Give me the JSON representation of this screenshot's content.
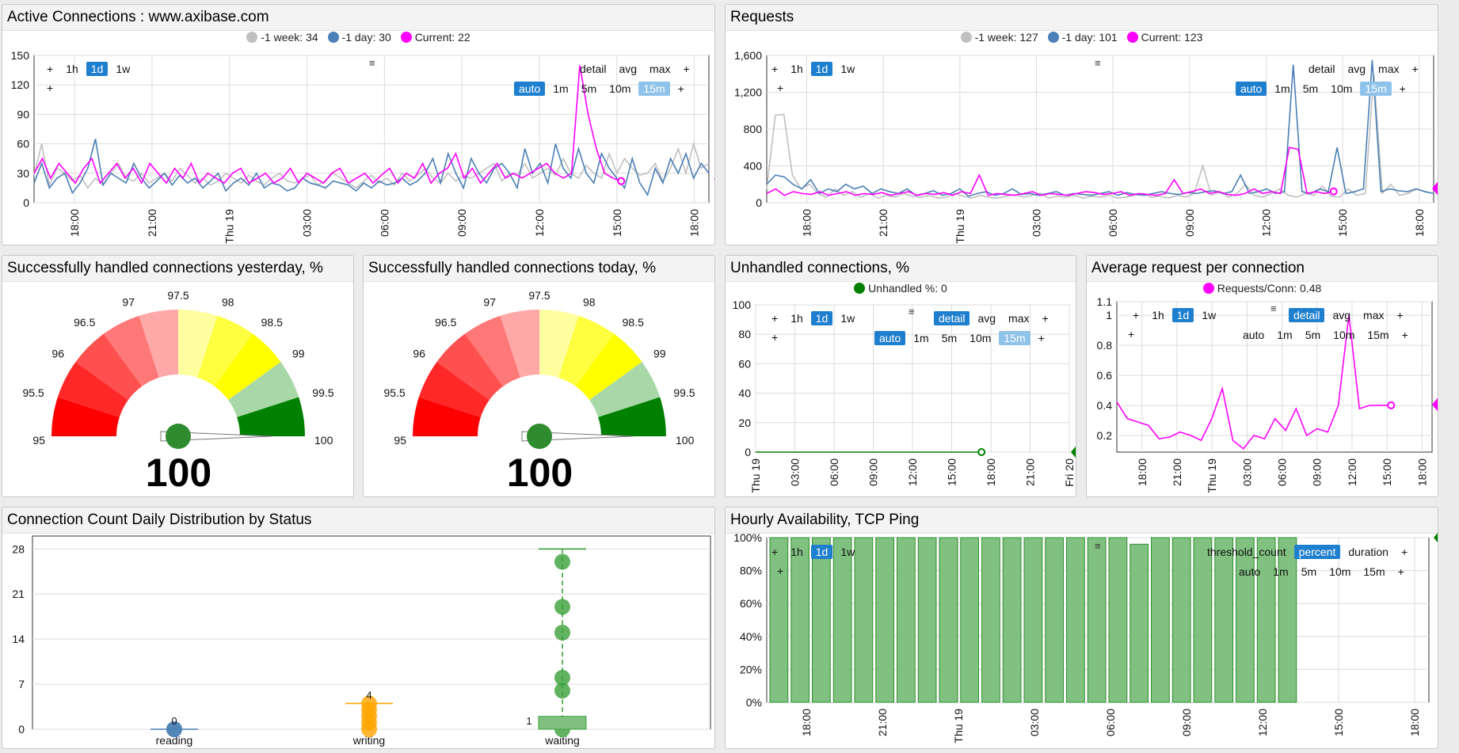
{
  "colors": {
    "week": "#c0c0c0",
    "day": "#4b7fb5",
    "current": "#ff00ff",
    "green": "#008000",
    "bar": "#80c080",
    "orange": "#ffa500"
  },
  "controls": {
    "plus": "+",
    "periods": [
      "1h",
      "1d",
      "1w"
    ],
    "stats": [
      "detail",
      "avg",
      "max"
    ],
    "intervals": [
      "auto",
      "1m",
      "5m",
      "10m",
      "15m"
    ],
    "menu_icon": "≡",
    "threshold_count": "threshold_count",
    "percent": "percent",
    "duration": "duration"
  },
  "active": {
    "title": "Active Connections : www.axibase.com",
    "legend": [
      "-1 week: 34",
      "-1 day: 30",
      "Current: 22"
    ],
    "yticks": [
      "150",
      "120",
      "90",
      "60",
      "30",
      "0"
    ],
    "xticks": [
      "18:00",
      "21:00",
      "Thu 19",
      "03:00",
      "06:00",
      "09:00",
      "12:00",
      "15:00",
      "18:00"
    ],
    "current_badge": "22",
    "chart_data": {
      "type": "line",
      "ylim": [
        0,
        150
      ],
      "x_range": [
        "Wed 18 16:30",
        "Thu 19 18:30"
      ],
      "series": [
        {
          "name": "-1 week",
          "values": [
            28,
            60,
            18,
            35,
            30,
            22,
            28,
            15,
            25,
            18,
            30,
            40,
            25,
            22,
            30,
            20,
            25,
            30,
            22,
            35,
            28,
            20,
            25,
            18,
            22,
            30,
            25,
            20,
            28,
            22,
            18,
            25,
            30,
            22,
            20,
            25,
            28,
            18,
            22,
            30,
            25,
            20,
            15,
            22,
            28,
            20,
            25,
            18,
            30,
            22,
            28,
            35,
            25,
            20,
            30,
            22,
            28,
            25,
            30,
            35,
            40,
            22,
            30,
            28,
            40,
            25,
            30,
            35,
            28,
            45,
            30,
            25,
            38,
            30,
            25,
            50,
            30,
            45,
            35,
            28,
            30,
            40,
            22,
            35,
            55,
            30,
            60,
            35,
            40
          ]
        },
        {
          "name": "-1 day",
          "values": [
            20,
            40,
            15,
            25,
            30,
            10,
            20,
            35,
            65,
            18,
            30,
            25,
            20,
            40,
            25,
            15,
            22,
            30,
            18,
            28,
            20,
            25,
            15,
            22,
            30,
            12,
            20,
            25,
            18,
            30,
            15,
            20,
            18,
            12,
            15,
            25,
            20,
            18,
            15,
            22,
            20,
            18,
            12,
            20,
            15,
            22,
            18,
            20,
            25,
            18,
            22,
            30,
            45,
            20,
            50,
            30,
            15,
            45,
            30,
            20,
            35,
            40,
            30,
            15,
            55,
            30,
            40,
            20,
            60,
            35,
            25,
            55,
            30,
            20,
            50,
            35,
            25,
            15,
            45,
            20,
            8,
            35,
            20,
            45,
            30,
            50,
            25,
            40,
            30
          ]
        },
        {
          "name": "Current",
          "values": [
            30,
            45,
            25,
            40,
            30,
            20,
            35,
            45,
            20,
            30,
            40,
            25,
            35,
            20,
            40,
            30,
            20,
            35,
            25,
            40,
            20,
            30,
            25,
            20,
            30,
            35,
            20,
            25,
            30,
            20,
            25,
            35,
            20,
            30,
            25,
            20,
            30,
            35,
            20,
            25,
            30,
            20,
            28,
            35,
            20,
            30,
            25,
            40,
            20,
            30,
            35,
            50,
            25,
            35,
            20,
            30,
            40,
            25,
            30,
            25,
            30,
            35,
            40,
            30,
            25,
            30,
            140,
            90,
            55,
            30,
            25,
            22
          ]
        }
      ]
    }
  },
  "requests": {
    "title": "Requests",
    "legend": [
      "-1 week: 127",
      "-1 day: 101",
      "Current: 123"
    ],
    "yticks": [
      "1,600",
      "1,200",
      "800",
      "400",
      "0"
    ],
    "xticks": [
      "18:00",
      "21:00",
      "Thu 19",
      "03:00",
      "06:00",
      "09:00",
      "12:00",
      "15:00",
      "18:00"
    ],
    "current_badge": "123",
    "chart_data": {
      "type": "line",
      "ylim": [
        0,
        1600
      ],
      "series": [
        {
          "name": "-1 week",
          "values": [
            150,
            950,
            960,
            300,
            150,
            200,
            100,
            60,
            150,
            80,
            120,
            60,
            100,
            50,
            80,
            60,
            100,
            70,
            60,
            80,
            50,
            60,
            100,
            70,
            50,
            80,
            60,
            50,
            70,
            90,
            60,
            80,
            100,
            50,
            70,
            60,
            80,
            50,
            70,
            60,
            80,
            50,
            60,
            80,
            100,
            60,
            70,
            50,
            80,
            60,
            100,
            400,
            80,
            120,
            60,
            100,
            200,
            80,
            60,
            100,
            150,
            80,
            60,
            100,
            80,
            180,
            70,
            60,
            150,
            80,
            100,
            1400,
            100,
            200,
            80,
            100,
            150,
            120,
            100
          ]
        },
        {
          "name": "-1 day",
          "values": [
            200,
            300,
            280,
            200,
            150,
            250,
            100,
            150,
            120,
            200,
            150,
            180,
            100,
            150,
            120,
            100,
            150,
            80,
            100,
            130,
            80,
            100,
            150,
            70,
            100,
            120,
            80,
            100,
            150,
            90,
            100,
            80,
            100,
            120,
            80,
            100,
            90,
            80,
            100,
            120,
            80,
            110,
            90,
            80,
            100,
            120,
            100,
            90,
            110,
            100,
            120,
            130,
            100,
            120,
            300,
            100,
            120,
            150,
            100,
            120,
            1500,
            120,
            100,
            150,
            120,
            600,
            100,
            120,
            150,
            1550,
            120,
            150,
            130,
            120,
            150,
            120,
            100
          ]
        },
        {
          "name": "Current",
          "values": [
            100,
            150,
            80,
            120,
            100,
            90,
            120,
            80,
            100,
            120,
            80,
            100,
            90,
            110,
            80,
            100,
            120,
            80,
            100,
            90,
            110,
            80,
            120,
            100,
            300,
            80,
            100,
            90,
            80,
            100,
            120,
            80,
            100,
            90,
            80,
            100,
            120,
            110,
            90,
            100,
            120,
            80,
            100,
            90,
            80,
            100,
            250,
            100,
            120,
            150,
            100,
            120,
            90,
            80,
            100,
            150,
            100,
            120,
            100,
            600,
            580,
            100,
            120,
            100,
            123
          ]
        }
      ]
    }
  },
  "gauge_yesterday": {
    "title": "Successfully handled connections yesterday, %",
    "value": "100",
    "ticks": [
      "95",
      "95.5",
      "96",
      "96.5",
      "97",
      "97.5",
      "98",
      "98.5",
      "99",
      "99.5",
      "100"
    ]
  },
  "gauge_today": {
    "title": "Successfully handled connections today, %",
    "value": "100",
    "ticks": [
      "95",
      "95.5",
      "96",
      "96.5",
      "97",
      "97.5",
      "98",
      "98.5",
      "99",
      "99.5",
      "100"
    ]
  },
  "unhandled": {
    "title": "Unhandled connections, %",
    "legend": "Unhandled %: 0",
    "yticks": [
      "100",
      "80",
      "60",
      "40",
      "20",
      "0"
    ],
    "xticks": [
      "Thu 19",
      "03:00",
      "06:00",
      "09:00",
      "12:00",
      "15:00",
      "18:00",
      "21:00",
      "Fri 20"
    ],
    "current_badge": "0",
    "chart_data": {
      "type": "line",
      "ylim": [
        0,
        100
      ],
      "series": [
        {
          "name": "Unhandled %",
          "values": [
            0,
            0,
            0,
            0,
            0,
            0,
            0,
            0
          ]
        }
      ]
    }
  },
  "avgreq": {
    "title": "Average request per connection",
    "legend": "Requests/Conn: 0.48",
    "yticks": [
      "1.1",
      "1",
      "0.8",
      "0.6",
      "0.4",
      "0.2"
    ],
    "xticks": [
      "18:00",
      "21:00",
      "Thu 19",
      "03:00",
      "06:00",
      "09:00",
      "12:00",
      "15:00",
      "18:00"
    ],
    "current_badge": "0.48",
    "chart_data": {
      "type": "line",
      "ylim": [
        0.2,
        1.1
      ],
      "series": [
        {
          "name": "Requests/Conn",
          "values": [
            0.5,
            0.4,
            0.38,
            0.36,
            0.28,
            0.29,
            0.32,
            0.3,
            0.27,
            0.4,
            0.58,
            0.27,
            0.22,
            0.3,
            0.28,
            0.4,
            0.33,
            0.46,
            0.3,
            0.34,
            0.32,
            0.48,
            1.02,
            0.46,
            0.48,
            0.48,
            0.48
          ]
        }
      ]
    }
  },
  "distribution": {
    "title": "Connection Count Daily Distribution by Status",
    "yticks": [
      "28",
      "21",
      "14",
      "7",
      "0"
    ],
    "categories": [
      "reading",
      "writing",
      "waiting"
    ],
    "labels": {
      "reading": "0",
      "writing": "4",
      "waiting": "1"
    },
    "chart_data": {
      "type": "box",
      "ylim": [
        0,
        30
      ],
      "series": [
        {
          "name": "reading",
          "min": 0,
          "max": 0,
          "points": [
            0,
            0
          ]
        },
        {
          "name": "writing",
          "min": 0,
          "max": 4,
          "points": [
            0,
            1,
            2,
            3,
            4
          ]
        },
        {
          "name": "waiting",
          "min": 0,
          "max": 28,
          "points": [
            0,
            6,
            8,
            15,
            19,
            26
          ]
        }
      ]
    }
  },
  "availability": {
    "title": "Hourly Availability, TCP Ping",
    "yticks": [
      "100%",
      "80%",
      "60%",
      "40%",
      "20%",
      "0%"
    ],
    "xticks": [
      "18:00",
      "21:00",
      "Thu 19",
      "03:00",
      "06:00",
      "09:00",
      "12:00",
      "15:00",
      "18:00"
    ],
    "current_badge": "100",
    "chart_data": {
      "type": "bar",
      "ylim": [
        0,
        100
      ],
      "values": [
        100,
        100,
        100,
        100,
        100,
        100,
        100,
        100,
        100,
        100,
        100,
        100,
        100,
        100,
        100,
        100,
        100,
        100,
        100,
        100,
        100,
        100,
        100,
        100,
        100,
        100,
        100,
        100,
        100,
        100,
        100,
        100,
        100,
        100,
        100,
        100,
        100,
        100,
        100,
        100,
        100,
        100,
        100,
        100,
        100,
        100,
        100,
        100,
        100,
        100,
        100,
        100,
        100,
        100,
        100,
        100,
        100,
        100,
        100,
        100,
        100,
        100,
        100,
        100,
        100,
        100,
        100,
        100,
        100,
        100,
        100,
        100,
        100,
        100,
        100,
        100,
        100,
        100,
        100,
        100,
        100,
        100,
        100,
        100,
        100,
        100,
        100,
        100,
        100,
        100,
        100,
        100,
        100,
        100,
        100,
        100,
        100,
        100,
        100,
        100,
        100,
        100,
        100,
        100,
        100,
        100,
        100,
        100,
        96,
        100,
        100,
        100,
        100,
        100,
        100,
        100,
        100,
        100,
        100,
        100,
        100,
        100,
        100,
        100,
        100
      ]
    }
  }
}
